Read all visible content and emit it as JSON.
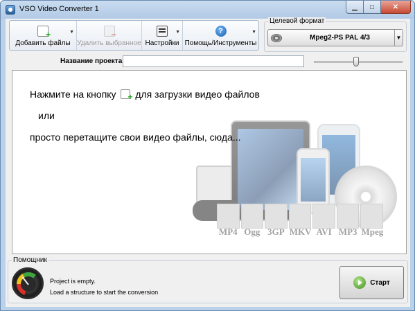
{
  "window": {
    "title": "VSO Video Converter 1"
  },
  "toolbar": {
    "add_files": "Добавить файлы",
    "remove_selected": "Удалить выбранное",
    "settings": "Настройки",
    "help_tools": "Помощь/Инструменты"
  },
  "target_format": {
    "legend": "Целевой формат",
    "value": "Mpeg2-PS PAL 4/3"
  },
  "project": {
    "label": "Название проекта:",
    "value": ""
  },
  "drop_area": {
    "line1_before": "Нажмите на кнопку",
    "line1_after": "для загрузки видео файлов",
    "line2": "или",
    "line3": "просто перетащите свои видео файлы, сюда..."
  },
  "watermark": {
    "formats": [
      "MP4",
      "Ogg",
      "3GP",
      "MKV",
      "AVI",
      "MP3",
      "Mpeg"
    ]
  },
  "assistant": {
    "legend": "Помощник",
    "line1": "Project is empty.",
    "line2": "Load a structure to start the conversion"
  },
  "start_button": {
    "label": "Старт"
  }
}
